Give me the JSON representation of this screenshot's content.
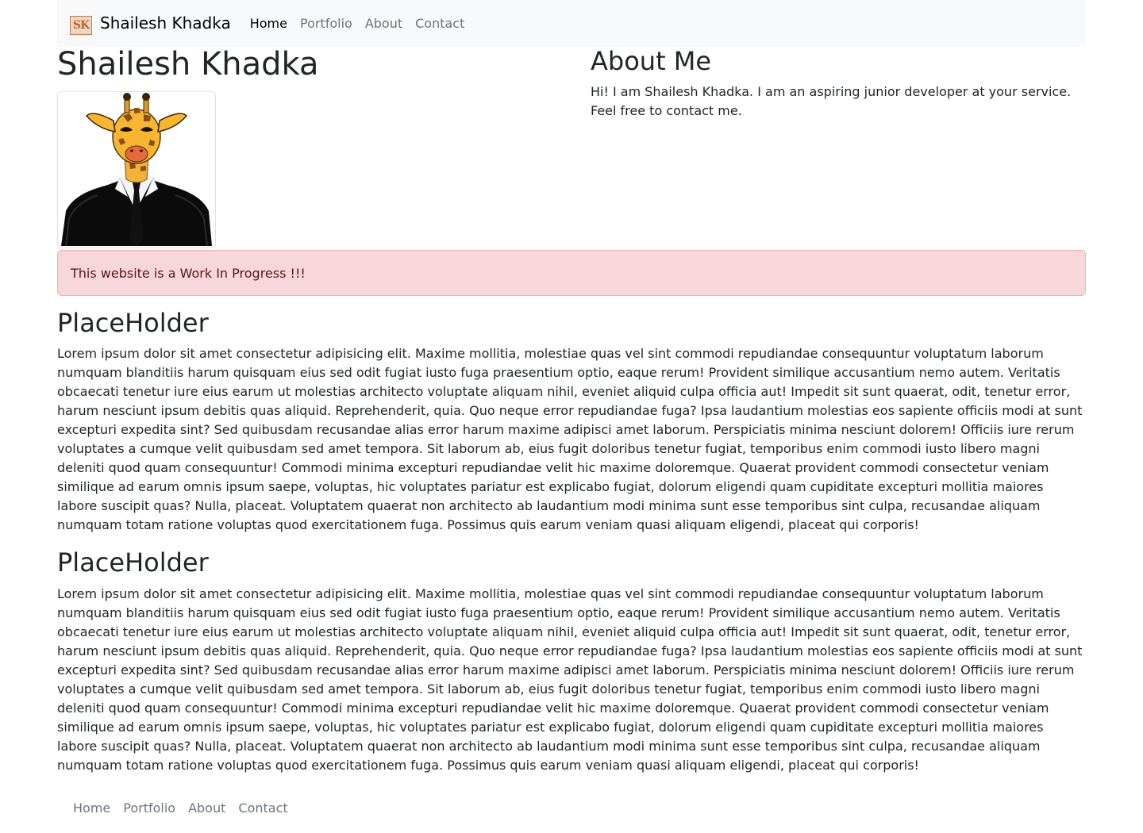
{
  "navbar": {
    "logo_text": "SK",
    "brand": "Shailesh Khadka",
    "links": [
      "Home",
      "Portfolio",
      "About",
      "Contact"
    ],
    "active": "Home"
  },
  "hero": {
    "title": "Shailesh Khadka"
  },
  "about": {
    "title": "About Me",
    "text": "Hi! I am Shailesh Khadka. I am an aspiring junior developer at your service. Feel free to contact me."
  },
  "alert": {
    "text": "This website is a Work In Progress !!!"
  },
  "sections": [
    {
      "title": "PlaceHolder",
      "body": "Lorem ipsum dolor sit amet consectetur adipisicing elit. Maxime mollitia, molestiae quas vel sint commodi repudiandae consequuntur voluptatum laborum numquam blanditiis harum quisquam eius sed odit fugiat iusto fuga praesentium optio, eaque rerum! Provident similique accusantium nemo autem. Veritatis obcaecati tenetur iure eius earum ut molestias architecto voluptate aliquam nihil, eveniet aliquid culpa officia aut! Impedit sit sunt quaerat, odit, tenetur error, harum nesciunt ipsum debitis quas aliquid. Reprehenderit, quia. Quo neque error repudiandae fuga? Ipsa laudantium molestias eos sapiente officiis modi at sunt excepturi expedita sint? Sed quibusdam recusandae alias error harum maxime adipisci amet laborum. Perspiciatis minima nesciunt dolorem! Officiis iure rerum voluptates a cumque velit quibusdam sed amet tempora. Sit laborum ab, eius fugit doloribus tenetur fugiat, temporibus enim commodi iusto libero magni deleniti quod quam consequuntur! Commodi minima excepturi repudiandae velit hic maxime doloremque. Quaerat provident commodi consectetur veniam similique ad earum omnis ipsum saepe, voluptas, hic voluptates pariatur est explicabo fugiat, dolorum eligendi quam cupiditate excepturi mollitia maiores labore suscipit quas? Nulla, placeat. Voluptatem quaerat non architecto ab laudantium modi minima sunt esse temporibus sint culpa, recusandae aliquam numquam totam ratione voluptas quod exercitationem fuga. Possimus quis earum veniam quasi aliquam eligendi, placeat qui corporis!"
    },
    {
      "title": "PlaceHolder",
      "body": "Lorem ipsum dolor sit amet consectetur adipisicing elit. Maxime mollitia, molestiae quas vel sint commodi repudiandae consequuntur voluptatum laborum numquam blanditiis harum quisquam eius sed odit fugiat iusto fuga praesentium optio, eaque rerum! Provident similique accusantium nemo autem. Veritatis obcaecati tenetur iure eius earum ut molestias architecto voluptate aliquam nihil, eveniet aliquid culpa officia aut! Impedit sit sunt quaerat, odit, tenetur error, harum nesciunt ipsum debitis quas aliquid. Reprehenderit, quia. Quo neque error repudiandae fuga? Ipsa laudantium molestias eos sapiente officiis modi at sunt excepturi expedita sint? Sed quibusdam recusandae alias error harum maxime adipisci amet laborum. Perspiciatis minima nesciunt dolorem! Officiis iure rerum voluptates a cumque velit quibusdam sed amet tempora. Sit laborum ab, eius fugit doloribus tenetur fugiat, temporibus enim commodi iusto libero magni deleniti quod quam consequuntur! Commodi minima excepturi repudiandae velit hic maxime doloremque. Quaerat provident commodi consectetur veniam similique ad earum omnis ipsum saepe, voluptas, hic voluptates pariatur est explicabo fugiat, dolorum eligendi quam cupiditate excepturi mollitia maiores labore suscipit quas? Nulla, placeat. Voluptatem quaerat non architecto ab laudantium modi minima sunt esse temporibus sint culpa, recusandae aliquam numquam totam ratione voluptas quod exercitationem fuga. Possimus quis earum veniam quasi aliquam eligendi, placeat qui corporis!"
    }
  ],
  "footer": {
    "links": [
      "Home",
      "Portfolio",
      "About",
      "Contact"
    ]
  },
  "colors": {
    "navbar_bg": "#f8f9fa",
    "alert_bg": "#f8d7da",
    "alert_text": "#58151c",
    "alert_border": "#f1aeb5",
    "logo_accent": "#c4652b"
  }
}
